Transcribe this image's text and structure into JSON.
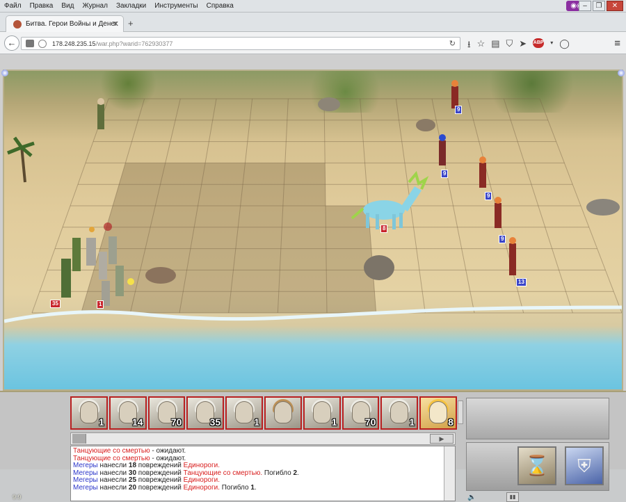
{
  "browser": {
    "menu": [
      "Файл",
      "Правка",
      "Вид",
      "Журнал",
      "Закладки",
      "Инструменты",
      "Справка"
    ],
    "tab_title": "Битва. Герои Войны и Денег.",
    "url_host": "178.248.235.15",
    "url_path": "/war.php?warid=762930377"
  },
  "battle": {
    "coord": "9:9",
    "left_stacks": [
      {
        "name": "stack-35",
        "count": "35"
      },
      {
        "name": "stack-1",
        "count": "1"
      }
    ],
    "right_stacks": [
      {
        "count": "9"
      },
      {
        "count": "9"
      },
      {
        "count": "9"
      },
      {
        "count": "9"
      },
      {
        "count": "13"
      }
    ],
    "unicorn_count": "8",
    "portraits": [
      {
        "count": "1"
      },
      {
        "count": "14"
      },
      {
        "count": "70"
      },
      {
        "count": "35"
      },
      {
        "count": "1"
      },
      {
        "count": ""
      },
      {
        "count": "1"
      },
      {
        "count": "70"
      },
      {
        "count": "1"
      },
      {
        "count": "8"
      }
    ],
    "log": {
      "l1a": "Танцующие со смертью",
      "l1b": " - ожидают.",
      "l2a": "Танцующие со смертью",
      "l2b": " - ожидают.",
      "l3a": "Мегеры",
      "l3b": " нанесли ",
      "l3n": "18",
      "l3c": " повреждений ",
      "l3d": "Единороги.",
      "l4a": "Мегеры",
      "l4b": " нанесли ",
      "l4n": "30",
      "l4c": " повреждений ",
      "l4d": "Танцующие со смертью.",
      "l4e": " Погибло ",
      "l4k": "2",
      "l4f": ".",
      "l5a": "Мегеры",
      "l5b": " нанесли ",
      "l5n": "25",
      "l5c": " повреждений ",
      "l5d": "Единороги.",
      "l6a": "Мегеры",
      "l6b": " нанесли ",
      "l6n": "20",
      "l6c": " повреждений ",
      "l6d": "Единороги.",
      "l6e": " Погибло ",
      "l6k": "1",
      "l6f": "."
    }
  }
}
